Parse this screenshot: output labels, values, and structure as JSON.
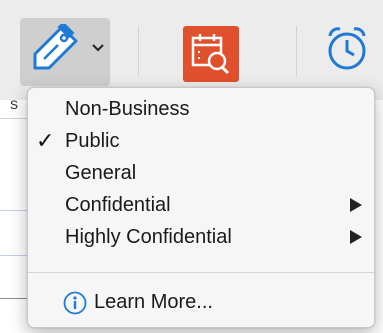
{
  "ribbon": {
    "sensitivity_label_stub": "S",
    "icons": [
      "sensitivity-label-icon",
      "chevron-down-icon",
      "calendar-review-icon",
      "alarm-clock-icon"
    ],
    "colors": {
      "accent_blue": "#1e7ad4",
      "review_orange": "#e0502d"
    }
  },
  "menu": {
    "items": [
      {
        "label": "Non-Business",
        "checked": false,
        "has_submenu": false
      },
      {
        "label": "Public",
        "checked": true,
        "has_submenu": false
      },
      {
        "label": "General",
        "checked": false,
        "has_submenu": false
      },
      {
        "label": "Confidential",
        "checked": false,
        "has_submenu": true
      },
      {
        "label": "Highly Confidential",
        "checked": false,
        "has_submenu": true
      }
    ],
    "checkmark": "✓",
    "learn_more": {
      "label": "Learn More...",
      "icon": "info-icon"
    }
  }
}
